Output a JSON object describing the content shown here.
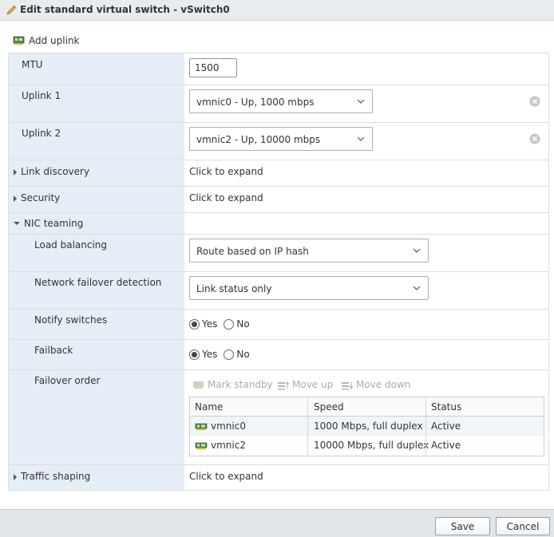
{
  "dialog": {
    "title": "Edit standard virtual switch - vSwitch0"
  },
  "toolbar": {
    "add_uplink_label": "Add uplink"
  },
  "mtu": {
    "label": "MTU",
    "value": "1500"
  },
  "uplinks": [
    {
      "label": "Uplink 1",
      "value": "vmnic0 - Up, 1000 mbps"
    },
    {
      "label": "Uplink 2",
      "value": "vmnic2 - Up, 10000 mbps"
    }
  ],
  "link_discovery": {
    "label": "Link discovery",
    "value": "Click to expand"
  },
  "security": {
    "label": "Security",
    "value": "Click to expand"
  },
  "nic_teaming": {
    "label": "NIC teaming",
    "load_balancing": {
      "label": "Load balancing",
      "value": "Route based on IP hash"
    },
    "failover_detection": {
      "label": "Network failover detection",
      "value": "Link status only"
    },
    "notify_switches": {
      "label": "Notify switches",
      "yes": "Yes",
      "no": "No",
      "selected": "Yes"
    },
    "failback": {
      "label": "Failback",
      "yes": "Yes",
      "no": "No",
      "selected": "Yes"
    },
    "failover_order": {
      "label": "Failover order",
      "actions": {
        "mark_standby": "Mark standby",
        "move_up": "Move up",
        "move_down": "Move down"
      },
      "columns": [
        "Name",
        "Speed",
        "Status"
      ],
      "rows": [
        {
          "name": "vmnic0",
          "speed": "1000 Mbps, full duplex",
          "status": "Active"
        },
        {
          "name": "vmnic2",
          "speed": "10000 Mbps, full duplex",
          "status": "Active"
        }
      ]
    }
  },
  "traffic_shaping": {
    "label": "Traffic shaping",
    "value": "Click to expand"
  },
  "footer": {
    "save_label": "Save",
    "cancel_label": "Cancel"
  },
  "colors": {
    "label_column_bg": "#e5eef6",
    "footer_bg": "#e1e5e9",
    "title_bg": "#e9ecef"
  },
  "icons": {
    "title": "pencil-icon",
    "add_uplink": "network-card-add-icon",
    "clear": "clear-circle-icon",
    "dropdown": "chevron-down-icon",
    "nic": "network-card-icon"
  }
}
